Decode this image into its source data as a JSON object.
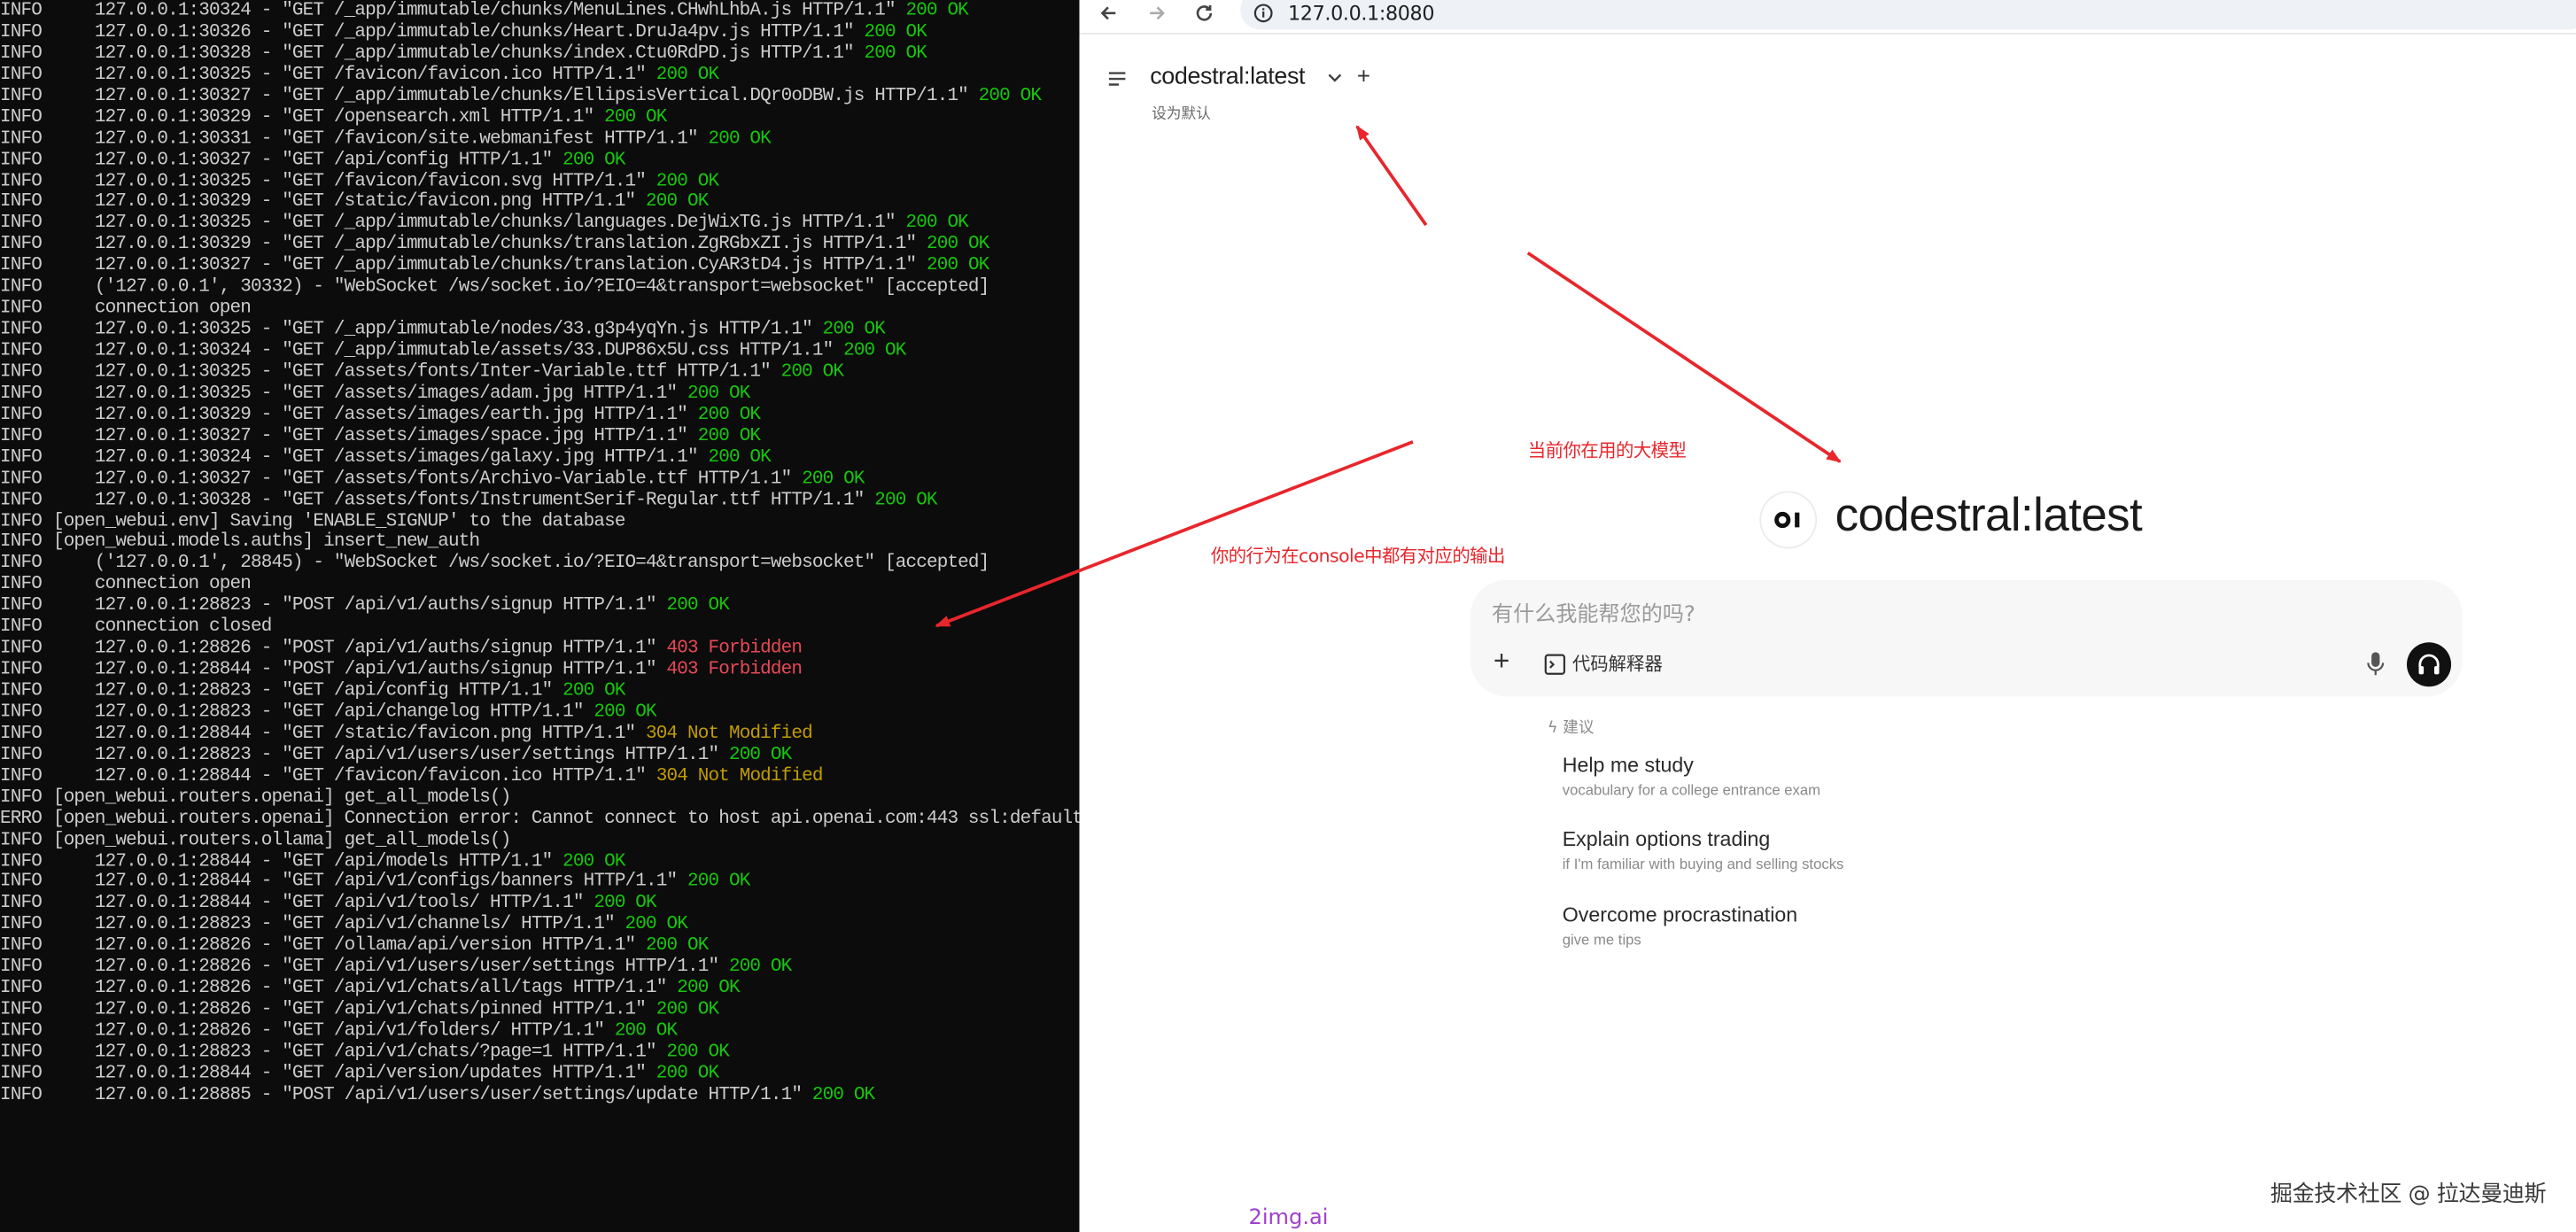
{
  "console": {
    "lines": [
      {
        "level": "INFO:",
        "text": "     127.0.0.1:30324 - \"GET /_app/immutable/chunks/MenuLines.CHwhLhbA.js HTTP/1.1\" ",
        "status": "200 OK",
        "kind": "ok"
      },
      {
        "level": "INFO:",
        "text": "     127.0.0.1:30326 - \"GET /_app/immutable/chunks/Heart.DruJa4pv.js HTTP/1.1\" ",
        "status": "200 OK",
        "kind": "ok"
      },
      {
        "level": "INFO:",
        "text": "     127.0.0.1:30328 - \"GET /_app/immutable/chunks/index.Ctu0RdPD.js HTTP/1.1\" ",
        "status": "200 OK",
        "kind": "ok"
      },
      {
        "level": "INFO:",
        "text": "     127.0.0.1:30325 - \"GET /favicon/favicon.ico HTTP/1.1\" ",
        "status": "200 OK",
        "kind": "ok"
      },
      {
        "level": "INFO:",
        "text": "     127.0.0.1:30327 - \"GET /_app/immutable/chunks/EllipsisVertical.DQr0oDBW.js HTTP/1.1\" ",
        "status": "200 OK",
        "kind": "ok"
      },
      {
        "level": "INFO:",
        "text": "     127.0.0.1:30329 - \"GET /opensearch.xml HTTP/1.1\" ",
        "status": "200 OK",
        "kind": "ok"
      },
      {
        "level": "INFO:",
        "text": "     127.0.0.1:30331 - \"GET /favicon/site.webmanifest HTTP/1.1\" ",
        "status": "200 OK",
        "kind": "ok"
      },
      {
        "level": "INFO:",
        "text": "     127.0.0.1:30327 - \"GET /api/config HTTP/1.1\" ",
        "status": "200 OK",
        "kind": "ok"
      },
      {
        "level": "INFO:",
        "text": "     127.0.0.1:30325 - \"GET /favicon/favicon.svg HTTP/1.1\" ",
        "status": "200 OK",
        "kind": "ok"
      },
      {
        "level": "INFO:",
        "text": "     127.0.0.1:30329 - \"GET /static/favicon.png HTTP/1.1\" ",
        "status": "200 OK",
        "kind": "ok"
      },
      {
        "level": "INFO:",
        "text": "     127.0.0.1:30325 - \"GET /_app/immutable/chunks/languages.DejWixTG.js HTTP/1.1\" ",
        "status": "200 OK",
        "kind": "ok"
      },
      {
        "level": "INFO:",
        "text": "     127.0.0.1:30329 - \"GET /_app/immutable/chunks/translation.ZgRGbxZI.js HTTP/1.1\" ",
        "status": "200 OK",
        "kind": "ok"
      },
      {
        "level": "INFO:",
        "text": "     127.0.0.1:30327 - \"GET /_app/immutable/chunks/translation.CyAR3tD4.js HTTP/1.1\" ",
        "status": "200 OK",
        "kind": "ok"
      },
      {
        "level": "INFO:",
        "text": "     ('127.0.0.1', 30332) - \"WebSocket /ws/socket.io/?EIO=4&transport=websocket\" [accepted]",
        "status": "",
        "kind": "plain"
      },
      {
        "level": "INFO:",
        "text": "     connection open",
        "status": "",
        "kind": "plain"
      },
      {
        "level": "INFO:",
        "text": "     127.0.0.1:30325 - \"GET /_app/immutable/nodes/33.g3p4yqYn.js HTTP/1.1\" ",
        "status": "200 OK",
        "kind": "ok"
      },
      {
        "level": "INFO:",
        "text": "     127.0.0.1:30324 - \"GET /_app/immutable/assets/33.DUP86x5U.css HTTP/1.1\" ",
        "status": "200 OK",
        "kind": "ok"
      },
      {
        "level": "INFO:",
        "text": "     127.0.0.1:30325 - \"GET /assets/fonts/Inter-Variable.ttf HTTP/1.1\" ",
        "status": "200 OK",
        "kind": "ok"
      },
      {
        "level": "INFO:",
        "text": "     127.0.0.1:30325 - \"GET /assets/images/adam.jpg HTTP/1.1\" ",
        "status": "200 OK",
        "kind": "ok"
      },
      {
        "level": "INFO:",
        "text": "     127.0.0.1:30329 - \"GET /assets/images/earth.jpg HTTP/1.1\" ",
        "status": "200 OK",
        "kind": "ok"
      },
      {
        "level": "INFO:",
        "text": "     127.0.0.1:30327 - \"GET /assets/images/space.jpg HTTP/1.1\" ",
        "status": "200 OK",
        "kind": "ok"
      },
      {
        "level": "INFO:",
        "text": "     127.0.0.1:30324 - \"GET /assets/images/galaxy.jpg HTTP/1.1\" ",
        "status": "200 OK",
        "kind": "ok"
      },
      {
        "level": "INFO:",
        "text": "     127.0.0.1:30327 - \"GET /assets/fonts/Archivo-Variable.ttf HTTP/1.1\" ",
        "status": "200 OK",
        "kind": "ok"
      },
      {
        "level": "INFO:",
        "text": "     127.0.0.1:30328 - \"GET /assets/fonts/InstrumentSerif-Regular.ttf HTTP/1.1\" ",
        "status": "200 OK",
        "kind": "ok"
      },
      {
        "level": "INFO ",
        "text": " [open_webui.env] Saving 'ENABLE_SIGNUP' to the database",
        "status": "",
        "kind": "plain"
      },
      {
        "level": "INFO ",
        "text": " [open_webui.models.auths] insert_new_auth",
        "status": "",
        "kind": "plain"
      },
      {
        "level": "INFO:",
        "text": "     ('127.0.0.1', 28845) - \"WebSocket /ws/socket.io/?EIO=4&transport=websocket\" [accepted]",
        "status": "",
        "kind": "plain"
      },
      {
        "level": "INFO:",
        "text": "     connection open",
        "status": "",
        "kind": "plain"
      },
      {
        "level": "INFO:",
        "text": "     127.0.0.1:28823 - \"POST /api/v1/auths/signup HTTP/1.1\" ",
        "status": "200 OK",
        "kind": "ok"
      },
      {
        "level": "INFO:",
        "text": "     connection closed",
        "status": "",
        "kind": "plain"
      },
      {
        "level": "INFO:",
        "text": "     127.0.0.1:28826 - \"POST /api/v1/auths/signup HTTP/1.1\" ",
        "status": "403 Forbidden",
        "kind": "err"
      },
      {
        "level": "INFO:",
        "text": "     127.0.0.1:28844 - \"POST /api/v1/auths/signup HTTP/1.1\" ",
        "status": "403 Forbidden",
        "kind": "err"
      },
      {
        "level": "INFO:",
        "text": "     127.0.0.1:28823 - \"GET /api/config HTTP/1.1\" ",
        "status": "200 OK",
        "kind": "ok"
      },
      {
        "level": "INFO:",
        "text": "     127.0.0.1:28823 - \"GET /api/changelog HTTP/1.1\" ",
        "status": "200 OK",
        "kind": "ok"
      },
      {
        "level": "INFO:",
        "text": "     127.0.0.1:28844 - \"GET /static/favicon.png HTTP/1.1\" ",
        "status": "304 Not Modified",
        "kind": "warn"
      },
      {
        "level": "INFO:",
        "text": "     127.0.0.1:28823 - \"GET /api/v1/users/user/settings HTTP/1.1\" ",
        "status": "200 OK",
        "kind": "ok"
      },
      {
        "level": "INFO:",
        "text": "     127.0.0.1:28844 - \"GET /favicon/favicon.ico HTTP/1.1\" ",
        "status": "304 Not Modified",
        "kind": "warn"
      },
      {
        "level": "INFO ",
        "text": " [open_webui.routers.openai] get_all_models()",
        "status": "",
        "kind": "plain"
      },
      {
        "level": "ERROR",
        "text": " [open_webui.routers.openai] Connection error: Cannot connect to host api.openai.com:443 ssl:default",
        "status": "",
        "kind": "plain"
      },
      {
        "level": "INFO ",
        "text": " [open_webui.routers.ollama] get_all_models()",
        "status": "",
        "kind": "plain"
      },
      {
        "level": "INFO:",
        "text": "     127.0.0.1:28844 - \"GET /api/models HTTP/1.1\" ",
        "status": "200 OK",
        "kind": "ok"
      },
      {
        "level": "INFO:",
        "text": "     127.0.0.1:28844 - \"GET /api/v1/configs/banners HTTP/1.1\" ",
        "status": "200 OK",
        "kind": "ok"
      },
      {
        "level": "INFO:",
        "text": "     127.0.0.1:28844 - \"GET /api/v1/tools/ HTTP/1.1\" ",
        "status": "200 OK",
        "kind": "ok"
      },
      {
        "level": "INFO:",
        "text": "     127.0.0.1:28823 - \"GET /api/v1/channels/ HTTP/1.1\" ",
        "status": "200 OK",
        "kind": "ok"
      },
      {
        "level": "INFO:",
        "text": "     127.0.0.1:28826 - \"GET /ollama/api/version HTTP/1.1\" ",
        "status": "200 OK",
        "kind": "ok"
      },
      {
        "level": "INFO:",
        "text": "     127.0.0.1:28826 - \"GET /api/v1/users/user/settings HTTP/1.1\" ",
        "status": "200 OK",
        "kind": "ok"
      },
      {
        "level": "INFO:",
        "text": "     127.0.0.1:28826 - \"GET /api/v1/chats/all/tags HTTP/1.1\" ",
        "status": "200 OK",
        "kind": "ok"
      },
      {
        "level": "INFO:",
        "text": "     127.0.0.1:28826 - \"GET /api/v1/chats/pinned HTTP/1.1\" ",
        "status": "200 OK",
        "kind": "ok"
      },
      {
        "level": "INFO:",
        "text": "     127.0.0.1:28826 - \"GET /api/v1/folders/ HTTP/1.1\" ",
        "status": "200 OK",
        "kind": "ok"
      },
      {
        "level": "INFO:",
        "text": "     127.0.0.1:28823 - \"GET /api/v1/chats/?page=1 HTTP/1.1\" ",
        "status": "200 OK",
        "kind": "ok"
      },
      {
        "level": "INFO:",
        "text": "     127.0.0.1:28844 - \"GET /api/version/updates HTTP/1.1\" ",
        "status": "200 OK",
        "kind": "ok"
      },
      {
        "level": "INFO:",
        "text": "     127.0.0.1:28885 - \"POST /api/v1/users/user/settings/update HTTP/1.1\" ",
        "status": "200 OK",
        "kind": "ok"
      }
    ]
  },
  "browser": {
    "url": "127.0.0.1:8080",
    "header": {
      "model_name": "codestral:latest",
      "set_default": "设为默认"
    },
    "hero": {
      "logo_text": "OI",
      "model_name": "codestral:latest"
    },
    "chat": {
      "placeholder": "有什么我能帮您的吗?",
      "code_interpreter": "代码解释器"
    },
    "suggestions": {
      "header": "建议",
      "items": [
        {
          "title": "Help me study",
          "subtitle": "vocabulary for a college entrance exam"
        },
        {
          "title": "Explain options trading",
          "subtitle": "if I'm familiar with buying and selling stocks"
        },
        {
          "title": "Overcome procrastination",
          "subtitle": "give me tips"
        }
      ]
    }
  },
  "annotations": {
    "current_model": "当前你在用的大模型",
    "console_output": "你的行为在console中都有对应的输出",
    "color": "#e8262c"
  },
  "watermarks": {
    "right": "掘金技术社区 @ 拉达曼迪斯",
    "bottom": "2img.ai"
  },
  "colors": {
    "status_ok": "#16c60c",
    "status_error": "#e74856",
    "status_warn": "#c19c00"
  }
}
